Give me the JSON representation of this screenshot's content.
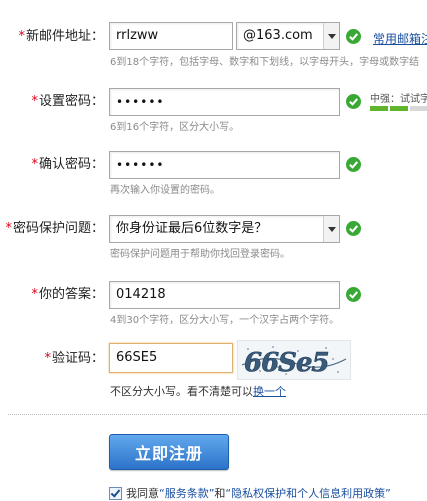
{
  "email": {
    "label": "新邮件地址：",
    "username_value": "rrlzww",
    "domain_value": "@163.com",
    "side_link": "常用邮箱注",
    "hint": "6到18个字符，包括字母、数字和下划线，以字母开头，字母或数字结"
  },
  "password": {
    "label": "设置密码：",
    "value": "••••••",
    "hint": "6到16个字符，区分大小写。",
    "strength_text": "中强：试试字",
    "strength_level": 0.6
  },
  "confirm": {
    "label": "确认密码：",
    "value": "••••••",
    "hint": "再次输入你设置的密码。"
  },
  "question": {
    "label": "密码保护问题：",
    "value": "你身份证最后6位数字是？",
    "hint": "密码保护问题用于帮助你找回登录密码。"
  },
  "answer": {
    "label": "你的答案：",
    "value": "014218",
    "hint": "4到30个字符，区分大小写，一个汉字占两个字符。"
  },
  "captcha": {
    "label": "验证码：",
    "value": "66SE5",
    "image_text": "66Se5",
    "hint_prefix": "不区分大小写。看不清楚可以",
    "hint_link": "换一个"
  },
  "register": {
    "label": "立即注册"
  },
  "agreement": {
    "prefix": "我同意",
    "terms": "“服务条款”",
    "and": "和",
    "privacy": "“隐私权保护和个人信息利用政策”"
  },
  "colors": {
    "required": "#e0001a",
    "valid": "#3aa835",
    "link": "#1a4fa0",
    "button": "#2c73c9"
  }
}
